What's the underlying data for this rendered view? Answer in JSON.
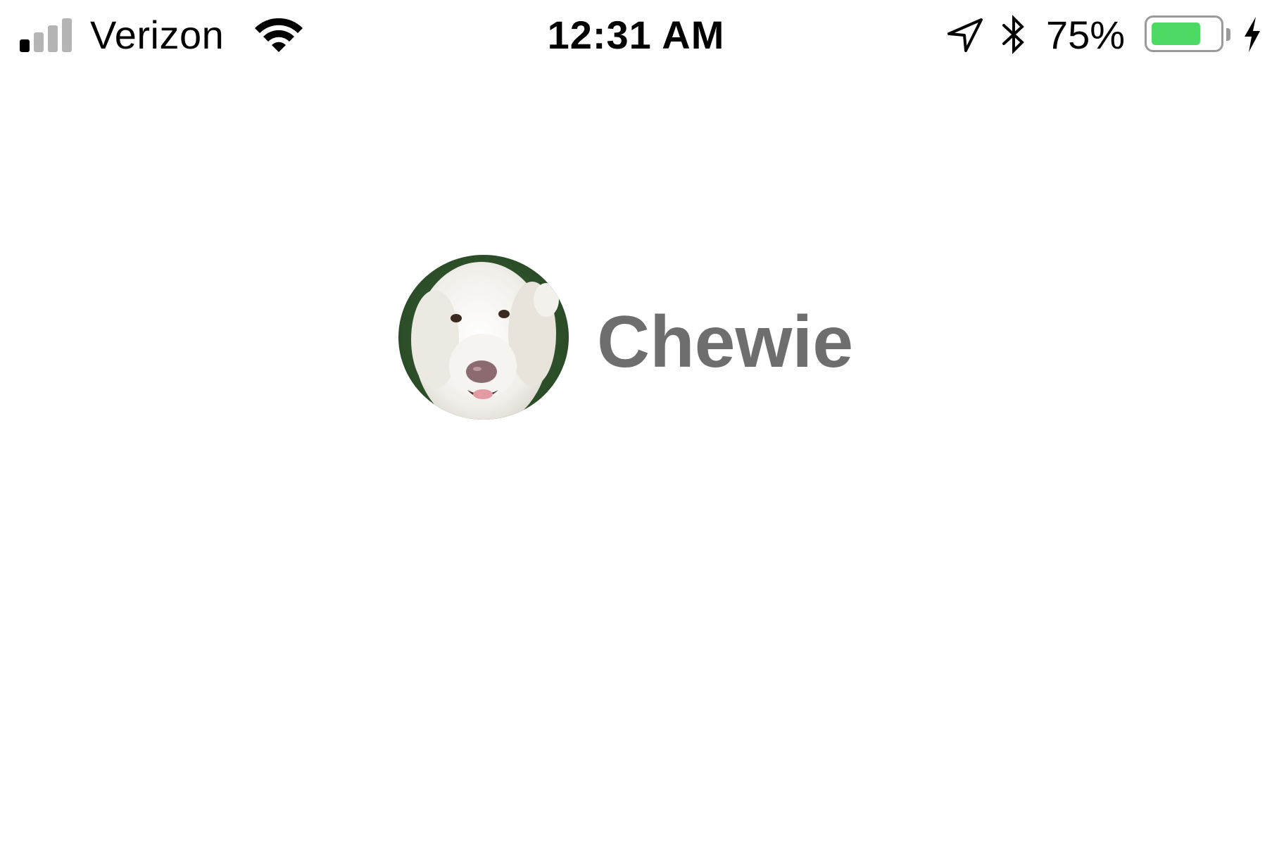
{
  "status_bar": {
    "carrier": "Verizon",
    "signal_bars_filled": 1,
    "signal_bars_total": 4,
    "time": "12:31 AM",
    "battery_percent_label": "75%",
    "battery_level": 0.75,
    "charging": true,
    "icons": [
      "signal-icon",
      "wifi-icon",
      "location-arrow-icon",
      "bluetooth-icon",
      "battery-icon",
      "charging-bolt-icon"
    ]
  },
  "profile": {
    "name": "Chewie",
    "avatar": "dog-photo"
  },
  "colors": {
    "battery_fill": "#4cd964",
    "signal_active": "#000000",
    "signal_inactive": "#b4b4b4",
    "name_text": "#6e6e6e"
  }
}
